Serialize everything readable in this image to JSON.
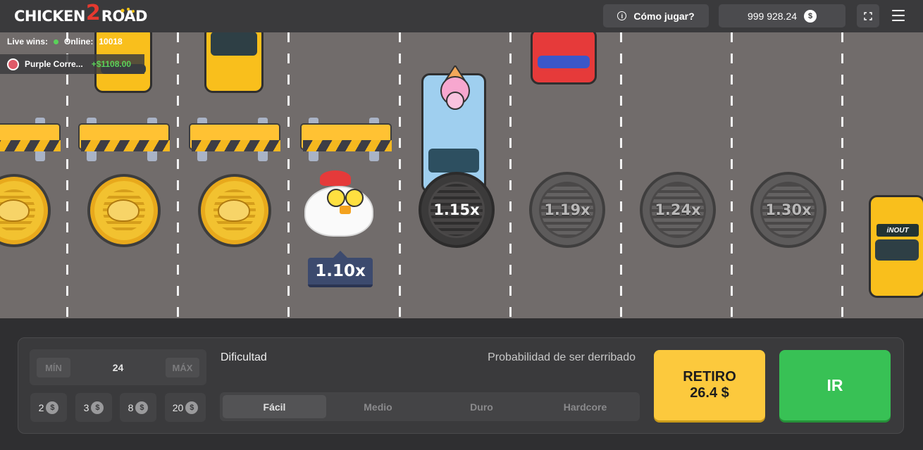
{
  "header": {
    "logo_left": "CHICKEN",
    "logo_num": "2",
    "logo_right": "ROAD",
    "how_to_play": "Cómo jugar?",
    "info_icon": "i",
    "balance": "999 928.24",
    "currency_symbol": "$"
  },
  "live": {
    "live_wins_label": "Live wins:",
    "online_label": "Online:",
    "online_count": "10018",
    "winner_name": "Purple Corre...",
    "winner_amount": "+$1108.00"
  },
  "road": {
    "current_multiplier": "1.10x",
    "multipliers": [
      "1.15x",
      "1.19x",
      "1.24x",
      "1.30x"
    ],
    "taxi_sign": "iNOUT"
  },
  "bet": {
    "min_label": "MÍN",
    "max_label": "MÁX",
    "value": "24",
    "chips": [
      "2",
      "3",
      "8",
      "20"
    ],
    "chip_currency": "$"
  },
  "difficulty": {
    "label": "Dificultad",
    "probability_label": "Probabilidad de ser derribado",
    "options": [
      "Fácil",
      "Medio",
      "Duro",
      "Hardcore"
    ],
    "selected": "Fácil"
  },
  "actions": {
    "cashout_label": "RETIRO",
    "cashout_amount": "26.4 $",
    "go_label": "IR"
  },
  "colors": {
    "road": "#716c6b",
    "cashout": "#fcc93d",
    "go": "#38c155",
    "badge": "#3c4a6e"
  }
}
